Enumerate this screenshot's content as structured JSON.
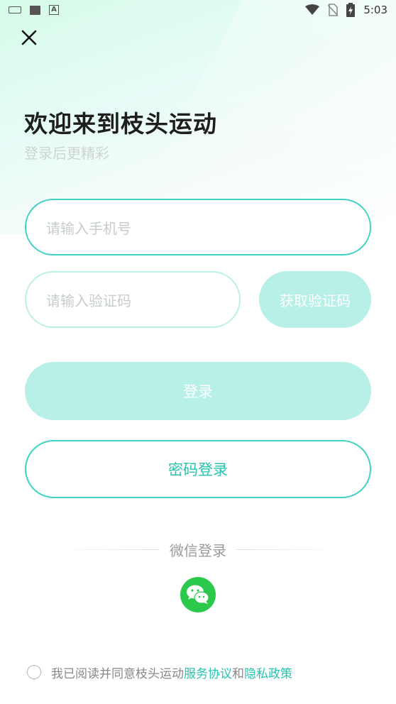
{
  "status_bar": {
    "time": "5:03",
    "left_icons": [
      "keyboard-icon",
      "image-icon",
      "a-icon"
    ],
    "right_icons": [
      "wifi-icon",
      "no-sim-icon",
      "battery-icon"
    ]
  },
  "header": {
    "title": "欢迎来到枝头运动",
    "subtitle": "登录后更精彩"
  },
  "form": {
    "phone_placeholder": "请输入手机号",
    "code_placeholder": "请输入验证码",
    "get_code_label": "获取验证码",
    "login_label": "登录",
    "password_login_label": "密码登录"
  },
  "social": {
    "divider_text": "微信登录",
    "wechat_icon": "wechat-icon"
  },
  "agreement": {
    "prefix": "我已阅读并同意枝头运动",
    "terms_link": "服务协议",
    "conjunction": "和",
    "privacy_link": "隐私政策"
  },
  "colors": {
    "accent": "#3ed3c1",
    "accent_text": "#27c3b0",
    "disabled_button": "#b8f0e7",
    "wechat_green": "#2bc94b"
  }
}
